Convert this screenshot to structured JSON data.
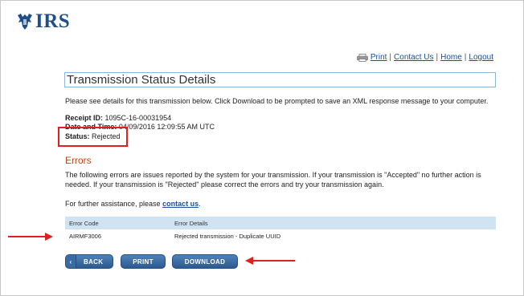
{
  "logo": {
    "text": "IRS",
    "icon": "eagle-emblem-icon"
  },
  "top_links": {
    "print": "Print",
    "contact": "Contact Us",
    "home": "Home",
    "logout": "Logout",
    "separator": "|"
  },
  "page_title": "Transmission Status Details",
  "intro": "Please see details for this transmission below. Click Download to be prompted to save an XML response message to your computer.",
  "details": {
    "receipt_label": "Receipt ID:",
    "receipt_value": "1095C-16-00031954",
    "date_label": "Date and Time:",
    "date_value": "04/09/2016 12:09:55 AM UTC",
    "status_label": "Status:",
    "status_value": "Rejected"
  },
  "errors": {
    "title": "Errors",
    "description": "The following errors are issues reported by the system for your transmission. If your transmission is \"Accepted\" no further action is needed. If your transmission is \"Rejected\" please correct the errors and try your transmission again.",
    "assist_prefix": "For further assistance, please",
    "assist_link": "contact us",
    "assist_suffix": ".",
    "columns": [
      "Error Code",
      "Error Details"
    ],
    "rows": [
      {
        "code": "AIRMF3006",
        "details": "Rejected transmission - Duplicate UUID"
      }
    ]
  },
  "buttons": {
    "back": "BACK",
    "print": "PRINT",
    "download": "DOWNLOAD"
  },
  "colors": {
    "accent": "#1f4f8b",
    "annotation_red": "#e02020",
    "errors_heading": "#b8471a",
    "table_header_bg": "#cfe3f2"
  }
}
